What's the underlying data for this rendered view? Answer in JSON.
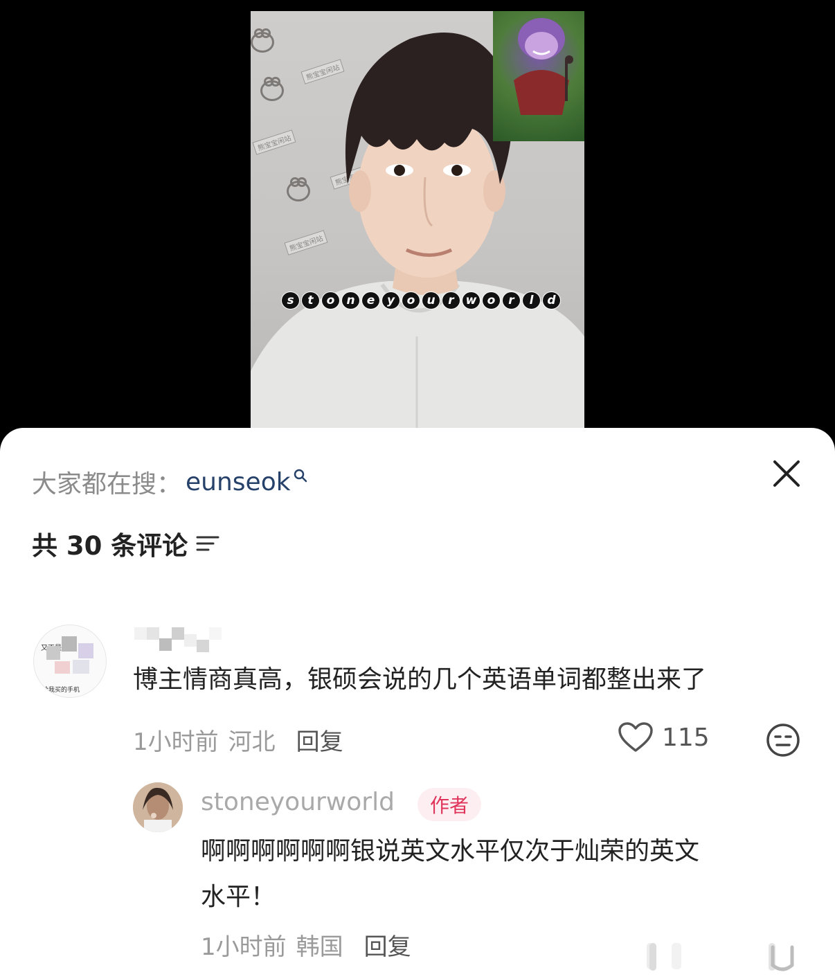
{
  "video": {
    "subtitle_letters": [
      "s",
      "t",
      "o",
      "n",
      "e",
      "y",
      "o",
      "u",
      "r",
      "w",
      "o",
      "r",
      "l",
      "d"
    ],
    "wall_logo_text": "熊宝宝闲站"
  },
  "sheet": {
    "search_prefix": "大家都在搜：",
    "search_term": "eunseok",
    "comment_count": "共 30 条评论"
  },
  "comments": [
    {
      "avatar_text_top": "又不是",
      "avatar_text_bottom": "给我买的手机",
      "text": "博主情商真高，银硕会说的几个英语单词都整出来了",
      "time": "1小时前",
      "location": "河北",
      "reply_label": "回复",
      "likes": "115",
      "replies": [
        {
          "username": "stoneyourworld",
          "badge": "作者",
          "text_line1": "啊啊啊啊啊啊银说英文水平仅次于灿荣的英文",
          "text_line2": "水平！",
          "time": "1小时前",
          "location": "韩国",
          "reply_label": "回复"
        }
      ]
    }
  ]
}
